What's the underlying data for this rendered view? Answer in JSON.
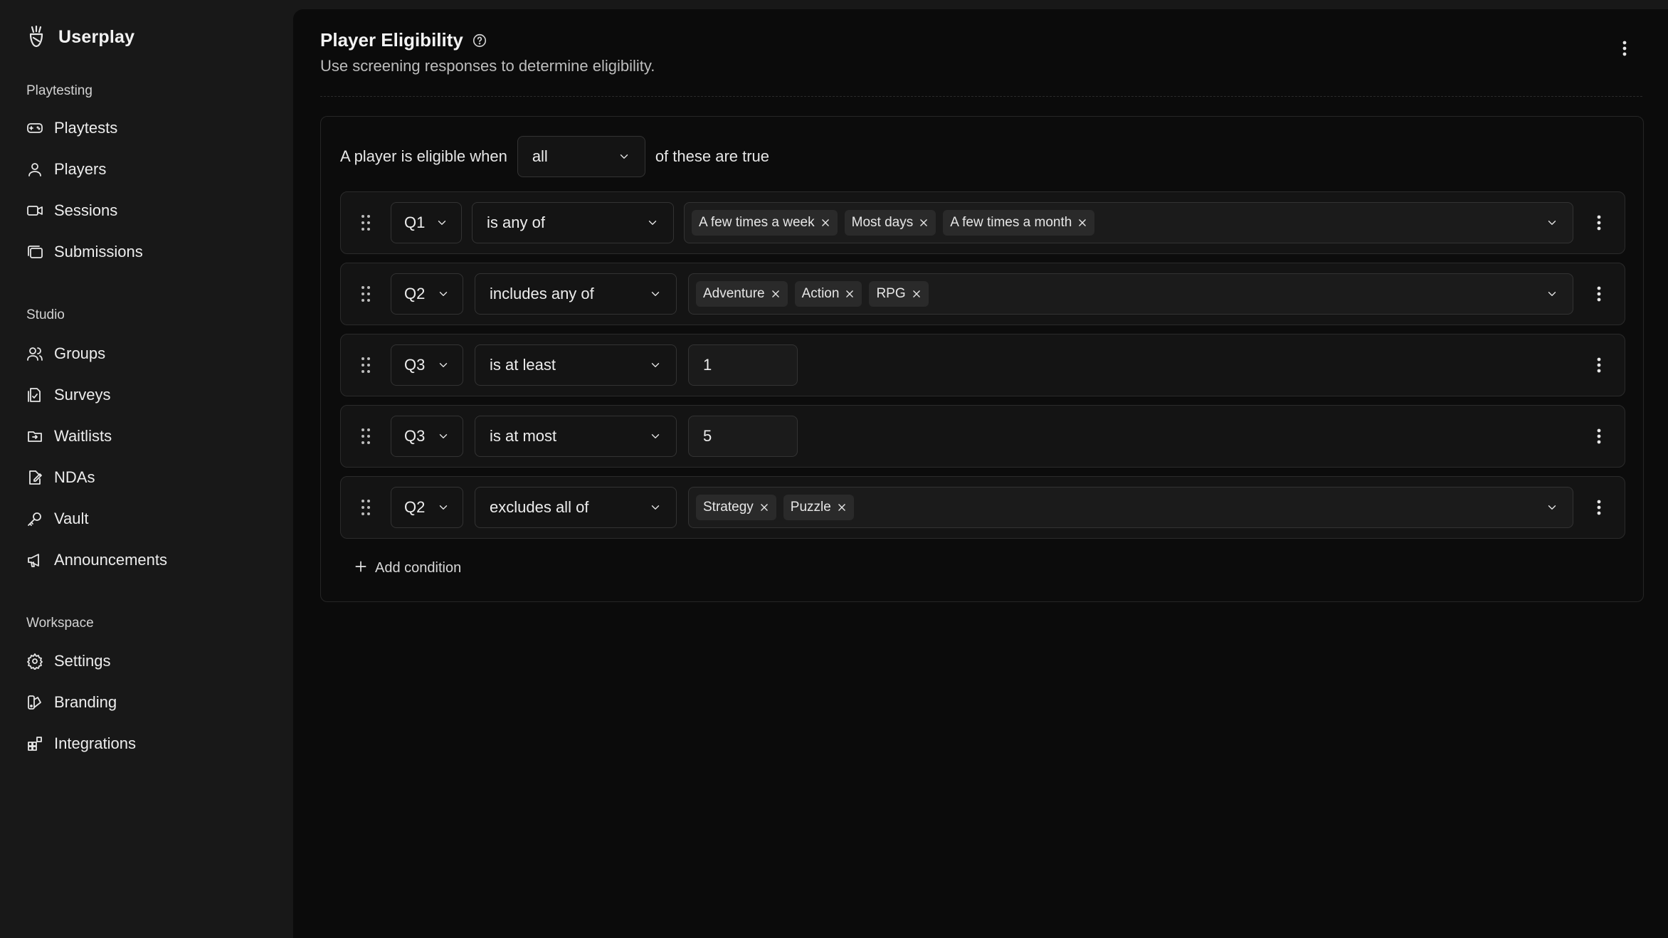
{
  "brand": {
    "name": "Userplay"
  },
  "sidebar": {
    "sections": [
      {
        "title": "Playtesting",
        "items": [
          {
            "label": "Playtests",
            "icon": "gamepad-icon"
          },
          {
            "label": "Players",
            "icon": "user-icon"
          },
          {
            "label": "Sessions",
            "icon": "video-icon"
          },
          {
            "label": "Submissions",
            "icon": "stack-icon"
          }
        ]
      },
      {
        "title": "Studio",
        "items": [
          {
            "label": "Groups",
            "icon": "users-icon"
          },
          {
            "label": "Surveys",
            "icon": "survey-icon"
          },
          {
            "label": "Waitlists",
            "icon": "waitlist-icon"
          },
          {
            "label": "NDAs",
            "icon": "document-edit-icon"
          },
          {
            "label": "Vault",
            "icon": "key-icon"
          },
          {
            "label": "Announcements",
            "icon": "megaphone-icon"
          }
        ]
      },
      {
        "title": "Workspace",
        "items": [
          {
            "label": "Settings",
            "icon": "gear-icon"
          },
          {
            "label": "Branding",
            "icon": "palette-icon"
          },
          {
            "label": "Integrations",
            "icon": "grid-plus-icon"
          }
        ]
      }
    ]
  },
  "header": {
    "title": "Player Eligibility",
    "subtitle": "Use screening responses to determine eligibility."
  },
  "rule": {
    "prefix": "A player is eligible when",
    "match": "all",
    "suffix": "of these are true",
    "conditions": [
      {
        "question": "Q1",
        "operator": "is any of",
        "values": [
          "A few times a week",
          "Most days",
          "A few times a month"
        ]
      },
      {
        "question": "Q2",
        "operator": "includes any of",
        "values": [
          "Adventure",
          "Action",
          "RPG"
        ]
      },
      {
        "question": "Q3",
        "operator": "is at least",
        "number": "1"
      },
      {
        "question": "Q3",
        "operator": "is at most",
        "number": "5"
      },
      {
        "question": "Q2",
        "operator": "excludes all of",
        "values": [
          "Strategy",
          "Puzzle"
        ]
      }
    ],
    "add_label": "Add condition"
  }
}
